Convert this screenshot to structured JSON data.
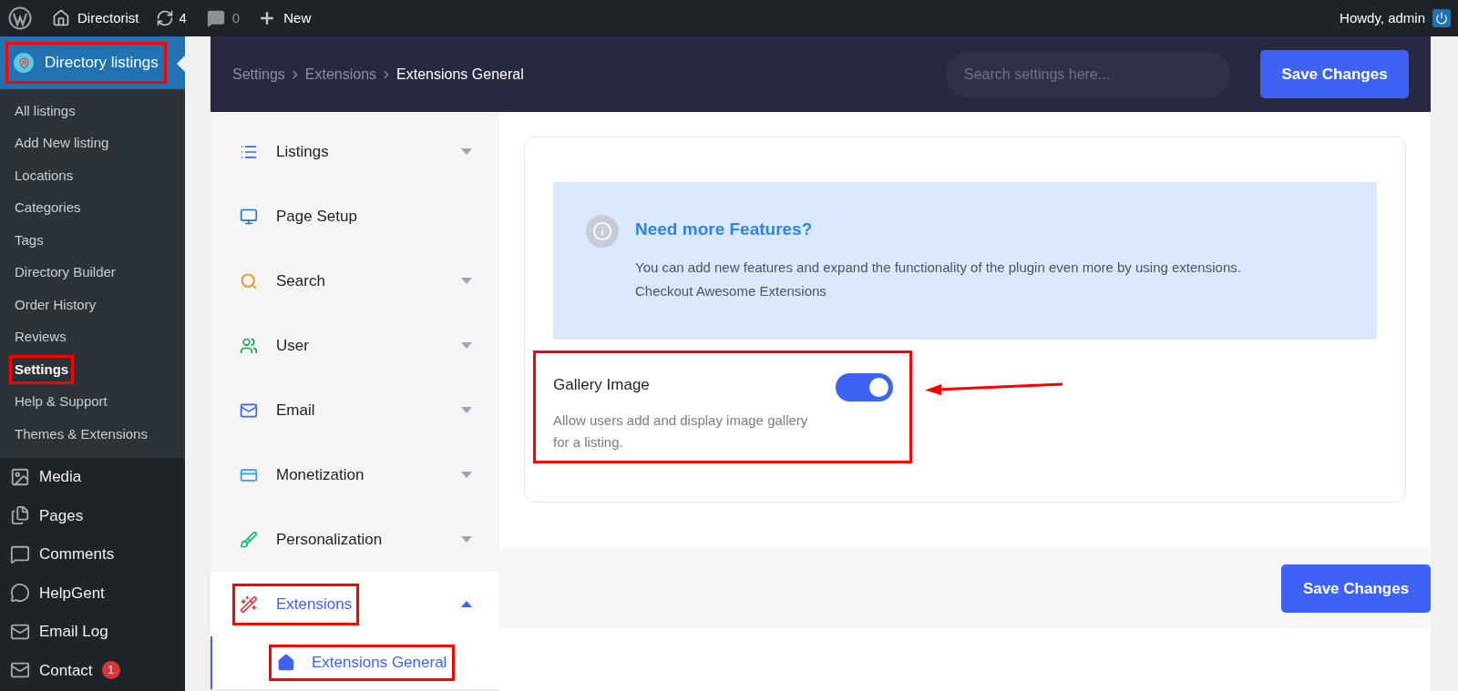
{
  "admin_bar": {
    "site": "Directorist",
    "updates": "4",
    "comments": "0",
    "new": "New",
    "greeting": "Howdy, admin"
  },
  "admin_menu": {
    "current": {
      "label": "Directory listings",
      "highlighted": true
    },
    "submenu": [
      {
        "label": "All listings",
        "selected": false,
        "highlighted": false
      },
      {
        "label": "Add New listing",
        "selected": false,
        "highlighted": false
      },
      {
        "label": "Locations",
        "selected": false,
        "highlighted": false
      },
      {
        "label": "Categories",
        "selected": false,
        "highlighted": false
      },
      {
        "label": "Tags",
        "selected": false,
        "highlighted": false
      },
      {
        "label": "Directory Builder",
        "selected": false,
        "highlighted": false
      },
      {
        "label": "Order History",
        "selected": false,
        "highlighted": false
      },
      {
        "label": "Reviews",
        "selected": false,
        "highlighted": false
      },
      {
        "label": "Settings",
        "selected": true,
        "highlighted": true
      },
      {
        "label": "Help & Support",
        "selected": false,
        "highlighted": false
      },
      {
        "label": "Themes & Extensions",
        "selected": false,
        "highlighted": false
      }
    ],
    "items": [
      {
        "label": "Media",
        "kind": "media"
      },
      {
        "label": "Pages",
        "kind": "pages"
      },
      {
        "label": "Comments",
        "kind": "comments"
      },
      {
        "label": "HelpGent",
        "kind": "chat"
      },
      {
        "label": "Email Log",
        "kind": "mail"
      },
      {
        "label": "Contact",
        "kind": "mail",
        "badge": "1"
      }
    ]
  },
  "header": {
    "breadcrumbs": [
      "Settings",
      "Extensions",
      "Extensions General"
    ],
    "search": {
      "placeholder": "Search settings here..."
    },
    "save": "Save Changes"
  },
  "settings_nav": [
    {
      "label": "Listings",
      "kind": "list",
      "expanded": false,
      "selected": false,
      "highlighted": false
    },
    {
      "label": "Page Setup",
      "kind": "monitor",
      "selected": false,
      "highlighted": false
    },
    {
      "label": "Search",
      "kind": "search",
      "expanded": false,
      "selected": false,
      "highlighted": false
    },
    {
      "label": "User",
      "kind": "users",
      "expanded": false,
      "selected": false,
      "highlighted": false
    },
    {
      "label": "Email",
      "kind": "mail",
      "expanded": false,
      "selected": false,
      "highlighted": false
    },
    {
      "label": "Monetization",
      "kind": "card",
      "expanded": false,
      "selected": false,
      "highlighted": false
    },
    {
      "label": "Personalization",
      "kind": "brush",
      "expanded": false,
      "selected": false,
      "highlighted": false
    },
    {
      "label": "Extensions",
      "kind": "wand",
      "expanded": true,
      "selected": true,
      "highlighted": true,
      "children": [
        {
          "label": "Extensions General",
          "selected": true,
          "highlighted": true
        }
      ]
    }
  ],
  "notice": {
    "title": "Need more Features?",
    "text": "You can add new features and expand the functionality of the plugin even more by using extensions.",
    "link": "Checkout Awesome Extensions"
  },
  "setting": {
    "label": "Gallery Image",
    "description": "Allow users add and display image gallery for a listing.",
    "on": true,
    "highlighted": true
  },
  "footer": {
    "save": "Save Changes"
  }
}
